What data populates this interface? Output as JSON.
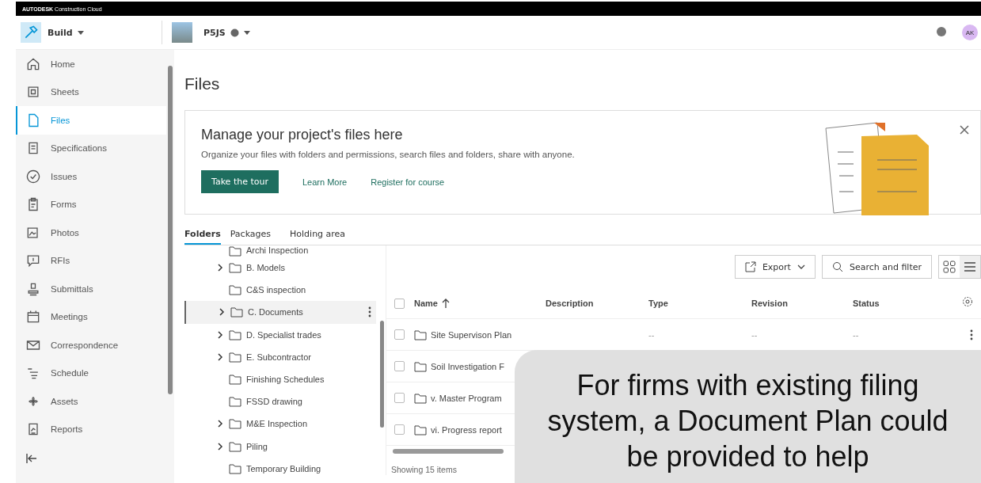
{
  "brand": {
    "logo": "AUTODESK",
    "product": "Construction Cloud"
  },
  "header": {
    "module": "Build",
    "project": "P5JS",
    "avatar": "AK"
  },
  "sidebar": {
    "items": [
      {
        "label": "Home",
        "selected": false
      },
      {
        "label": "Sheets",
        "selected": false
      },
      {
        "label": "Files",
        "selected": true
      },
      {
        "label": "Specifications",
        "selected": false
      },
      {
        "label": "Issues",
        "selected": false
      },
      {
        "label": "Forms",
        "selected": false
      },
      {
        "label": "Photos",
        "selected": false
      },
      {
        "label": "RFIs",
        "selected": false
      },
      {
        "label": "Submittals",
        "selected": false
      },
      {
        "label": "Meetings",
        "selected": false
      },
      {
        "label": "Correspondence",
        "selected": false
      },
      {
        "label": "Schedule",
        "selected": false
      },
      {
        "label": "Assets",
        "selected": false
      },
      {
        "label": "Reports",
        "selected": false
      }
    ]
  },
  "page_title": "Files",
  "banner": {
    "title": "Manage your project's files here",
    "text": "Organize your files with folders and permissions, search files and folders, share with anyone.",
    "primary": "Take the tour",
    "links": [
      "Learn More",
      "Register for course"
    ]
  },
  "tabs": [
    {
      "label": "Folders",
      "selected": true
    },
    {
      "label": "Packages",
      "selected": false
    },
    {
      "label": "Holding area",
      "selected": false
    }
  ],
  "folders": [
    {
      "name": "Archi Inspection",
      "expandable": false,
      "selected": false
    },
    {
      "name": "B. Models",
      "expandable": true,
      "selected": false
    },
    {
      "name": "C&S inspection",
      "expandable": false,
      "selected": false
    },
    {
      "name": "C. Documents",
      "expandable": true,
      "selected": true
    },
    {
      "name": "D. Specialist trades",
      "expandable": true,
      "selected": false
    },
    {
      "name": "E. Subcontractor",
      "expandable": true,
      "selected": false
    },
    {
      "name": "Finishing Schedules",
      "expandable": false,
      "selected": false
    },
    {
      "name": "FSSD drawing",
      "expandable": false,
      "selected": false
    },
    {
      "name": "M&E Inspection",
      "expandable": true,
      "selected": false
    },
    {
      "name": "Piling",
      "expandable": true,
      "selected": false
    },
    {
      "name": "Temporary Building",
      "expandable": false,
      "selected": false
    }
  ],
  "toolbar": {
    "export": "Export",
    "search": "Search and filter"
  },
  "table": {
    "all_checked": false,
    "columns": [
      "Name",
      "Description",
      "Type",
      "Revision",
      "Status"
    ],
    "rows": [
      {
        "name": "Site Supervison Plan",
        "checked": false,
        "type": "--",
        "revision": "--",
        "status": "--"
      },
      {
        "name": "Soil Investigation F",
        "checked": false
      },
      {
        "name": "v. Master Program",
        "checked": false
      },
      {
        "name": "vi. Progress report",
        "checked": false
      }
    ],
    "footer": "Showing 15 items"
  },
  "callout": "For firms with existing filing system, a Document Plan could be provided to help"
}
